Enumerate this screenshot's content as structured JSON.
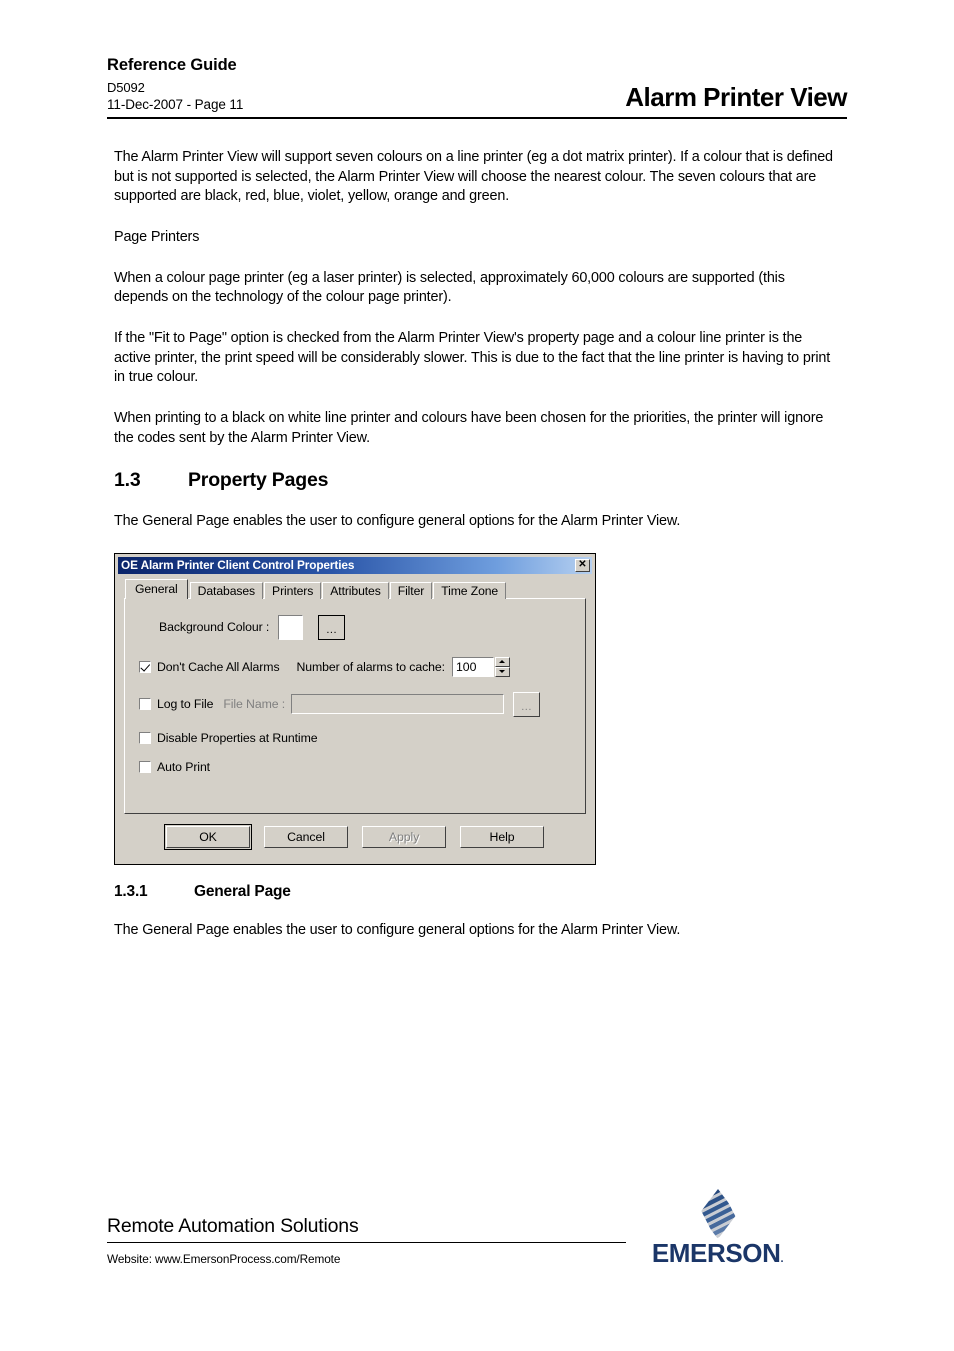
{
  "header": {
    "title": "Reference Guide",
    "doc_code": "D5092",
    "date_page": "11-Dec-2007 - Page 11",
    "product_title": "Alarm Printer View"
  },
  "body": {
    "para1": "The Alarm Printer View will support seven colours on a line printer (eg a dot matrix printer). If a colour that is defined but is not supported is selected, the Alarm Printer View will choose the nearest colour. The seven colours that are supported are black, red, blue, violet, yellow, orange and green.",
    "para2": "Page Printers",
    "para3": "When a colour page printer (eg a laser printer) is selected, approximately 60,000 colours are supported (this depends on the technology of the colour page printer).",
    "para4": "If the \"Fit to Page\" option is checked from the Alarm Printer View's property page and a colour line printer is the active printer, the print speed will be considerably slower. This is due to the fact that the line printer is having to print in true colour.",
    "para5": "When printing to a black on white line printer and colours have been chosen for the priorities, the printer will ignore the codes sent by the Alarm Printer View.",
    "section_number": "1.3",
    "section_title": "Property Pages",
    "para6": "The General Page enables the user to configure general options for the Alarm Printer View.",
    "subsection_number": "1.3.1",
    "subsection_title": "General Page",
    "para7": "The General Page enables the user to configure general options for the Alarm Printer View."
  },
  "dialog": {
    "title": "OE Alarm Printer Client Control Properties",
    "close_label": "✕",
    "tabs": [
      {
        "label": "General",
        "active": true
      },
      {
        "label": "Databases",
        "active": false
      },
      {
        "label": "Printers",
        "active": false
      },
      {
        "label": "Attributes",
        "active": false
      },
      {
        "label": "Filter",
        "active": false
      },
      {
        "label": "Time Zone",
        "active": false
      }
    ],
    "fields": {
      "background_colour_label": "Background Colour :",
      "background_colour_value": "#ffffff",
      "browse_colour_label": "...",
      "dont_cache_label": "Don't Cache All Alarms",
      "dont_cache_checked": true,
      "num_alarms_label": "Number of alarms to cache:",
      "num_alarms_value": "100",
      "log_to_file_label": "Log to File",
      "log_to_file_checked": false,
      "file_name_label": "File Name :",
      "file_name_value": "",
      "browse_file_label": "...",
      "disable_properties_label": "Disable Properties at Runtime",
      "disable_properties_checked": false,
      "auto_print_label": "Auto Print",
      "auto_print_checked": false
    },
    "buttons": {
      "ok": "OK",
      "cancel": "Cancel",
      "apply": "Apply",
      "help": "Help"
    }
  },
  "footer": {
    "tagline": "Remote Automation Solutions",
    "website": "Website:  www.EmersonProcess.com/Remote",
    "logo_word": "EMERSON",
    "logo_tm": ".",
    "brand_color": "#1b3668"
  }
}
